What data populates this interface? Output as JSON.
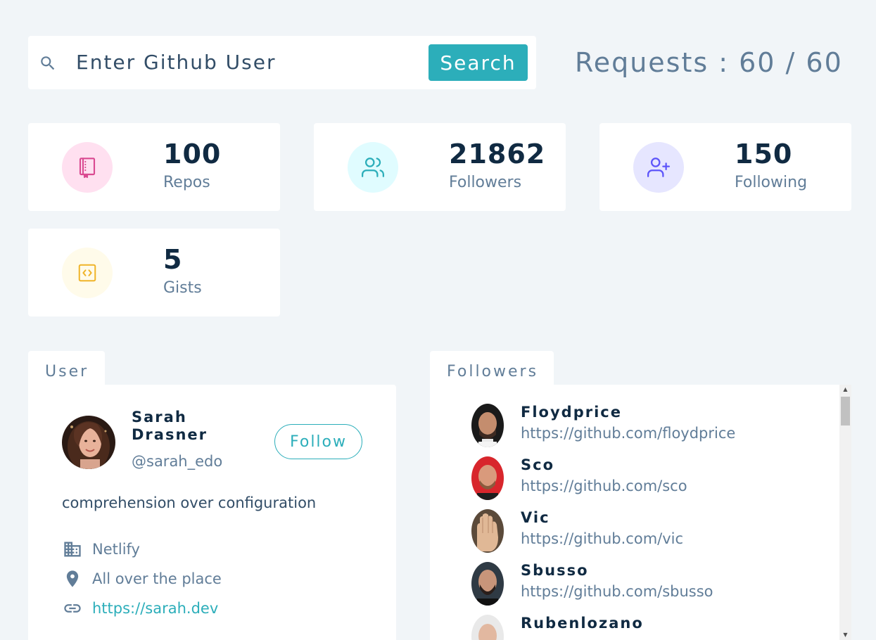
{
  "search": {
    "placeholder": "Enter Github User",
    "button_label": "Search",
    "icon": "search-icon"
  },
  "requests": {
    "text": "Requests : 60 / 60"
  },
  "stats": [
    {
      "value": "100",
      "label": "Repos",
      "icon": "book-icon",
      "icon_color": "#da4a91",
      "bg_color": "#ffe0f0"
    },
    {
      "value": "21862",
      "label": "Followers",
      "icon": "users-icon",
      "icon_color": "#2caeba",
      "bg_color": "#e0fcff"
    },
    {
      "value": "150",
      "label": "Following",
      "icon": "user-plus-icon",
      "icon_color": "#5d55fa",
      "bg_color": "#e6e6ff"
    },
    {
      "value": "5",
      "label": "Gists",
      "icon": "code-icon",
      "icon_color": "#f0b429",
      "bg_color": "#fffbea"
    }
  ],
  "user_panel": {
    "tab_label": "User",
    "name": "Sarah Drasner",
    "handle": "@sarah_edo",
    "follow_label": "Follow",
    "bio": "comprehension over configuration",
    "company": "Netlify",
    "location": "All over the place",
    "blog": "https://sarah.dev"
  },
  "followers_panel": {
    "tab_label": "Followers",
    "items": [
      {
        "name": "Floydprice",
        "url": "https://github.com/floydprice"
      },
      {
        "name": "Sco",
        "url": "https://github.com/sco"
      },
      {
        "name": "Vic",
        "url": "https://github.com/vic"
      },
      {
        "name": "Sbusso",
        "url": "https://github.com/sbusso"
      },
      {
        "name": "Rubenlozano",
        "url": ""
      }
    ]
  },
  "colors": {
    "accent": "#2caeba",
    "background": "#f1f5f8",
    "heading": "#102a42",
    "muted": "#617d98"
  }
}
